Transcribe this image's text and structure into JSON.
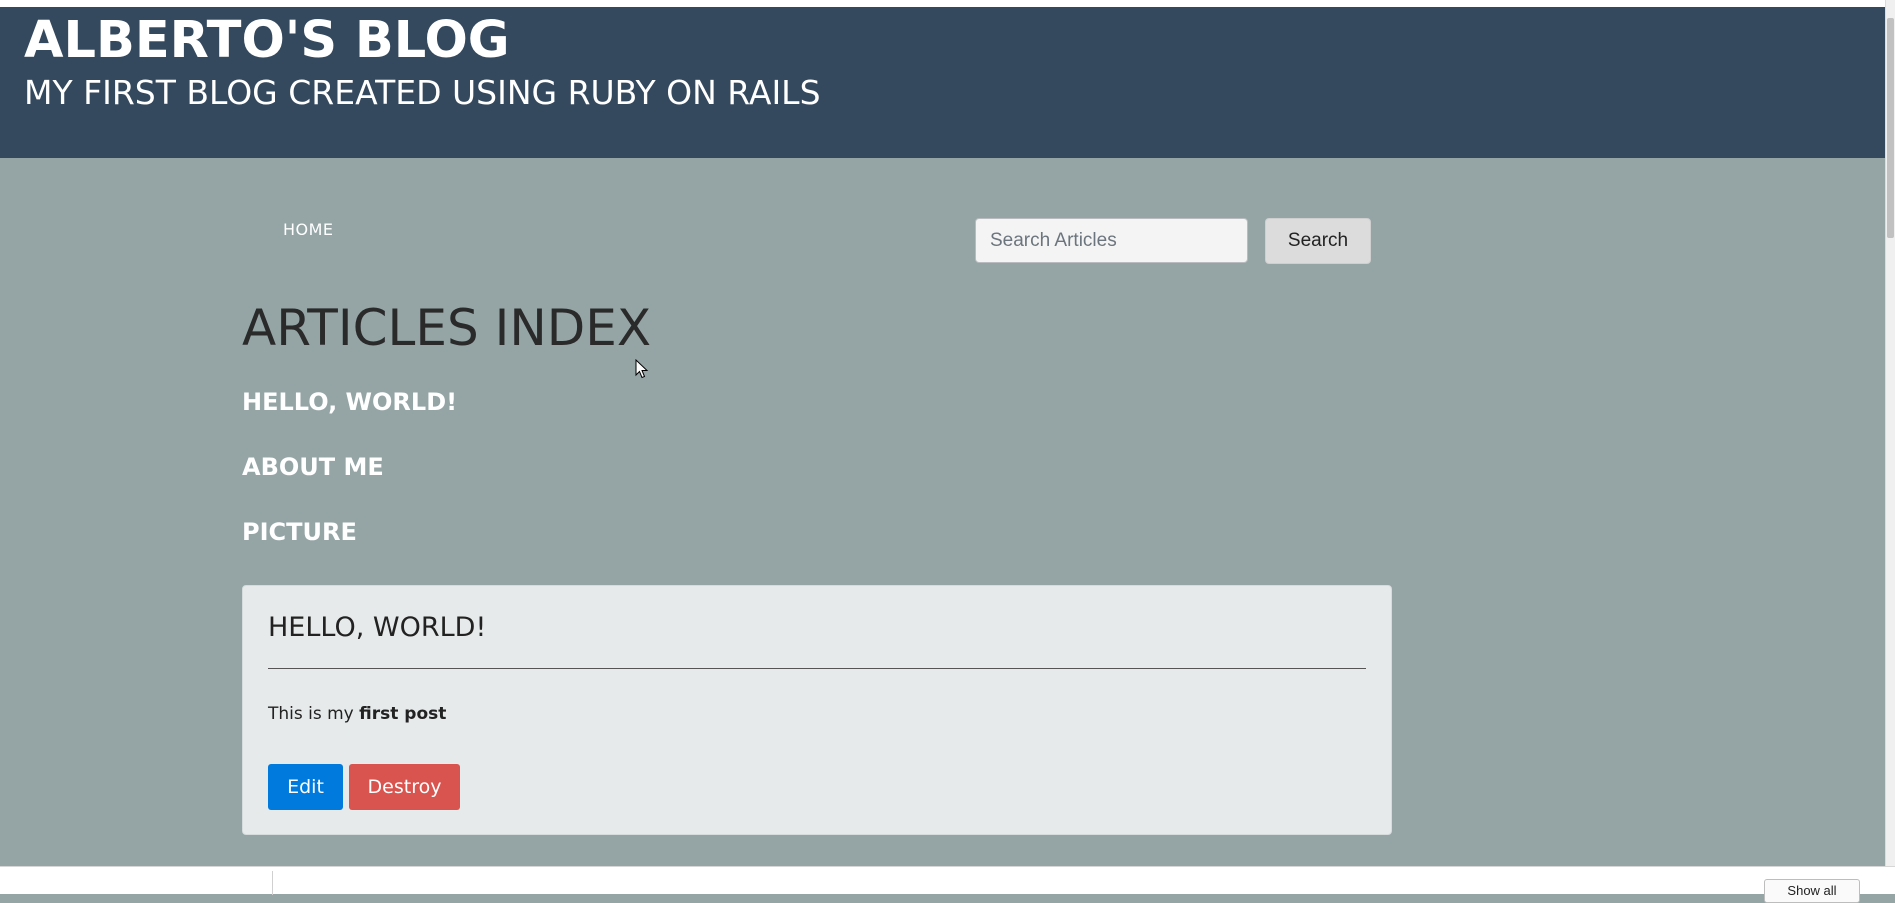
{
  "header": {
    "title": "ALBERTO'S BLOG",
    "subtitle": "MY FIRST BLOG CREATED USING RUBY ON RAILS"
  },
  "nav": {
    "home_label": "HOME"
  },
  "search": {
    "placeholder": "Search Articles",
    "button_label": "Search"
  },
  "main": {
    "heading": "ARTICLES INDEX",
    "article_links": [
      "HELLO, WORLD!",
      "ABOUT ME",
      "PICTURE"
    ]
  },
  "card": {
    "title": "HELLO, WORLD!",
    "body_prefix": "This is my ",
    "body_bold": "first post",
    "edit_label": "Edit",
    "destroy_label": "Destroy"
  },
  "statusbar": {
    "show_all_label": "Show all"
  },
  "colors": {
    "header_bg": "#34495e",
    "page_bg": "#95a5a6",
    "edit_button": "#007bdd",
    "destroy_button": "#d9534f"
  }
}
